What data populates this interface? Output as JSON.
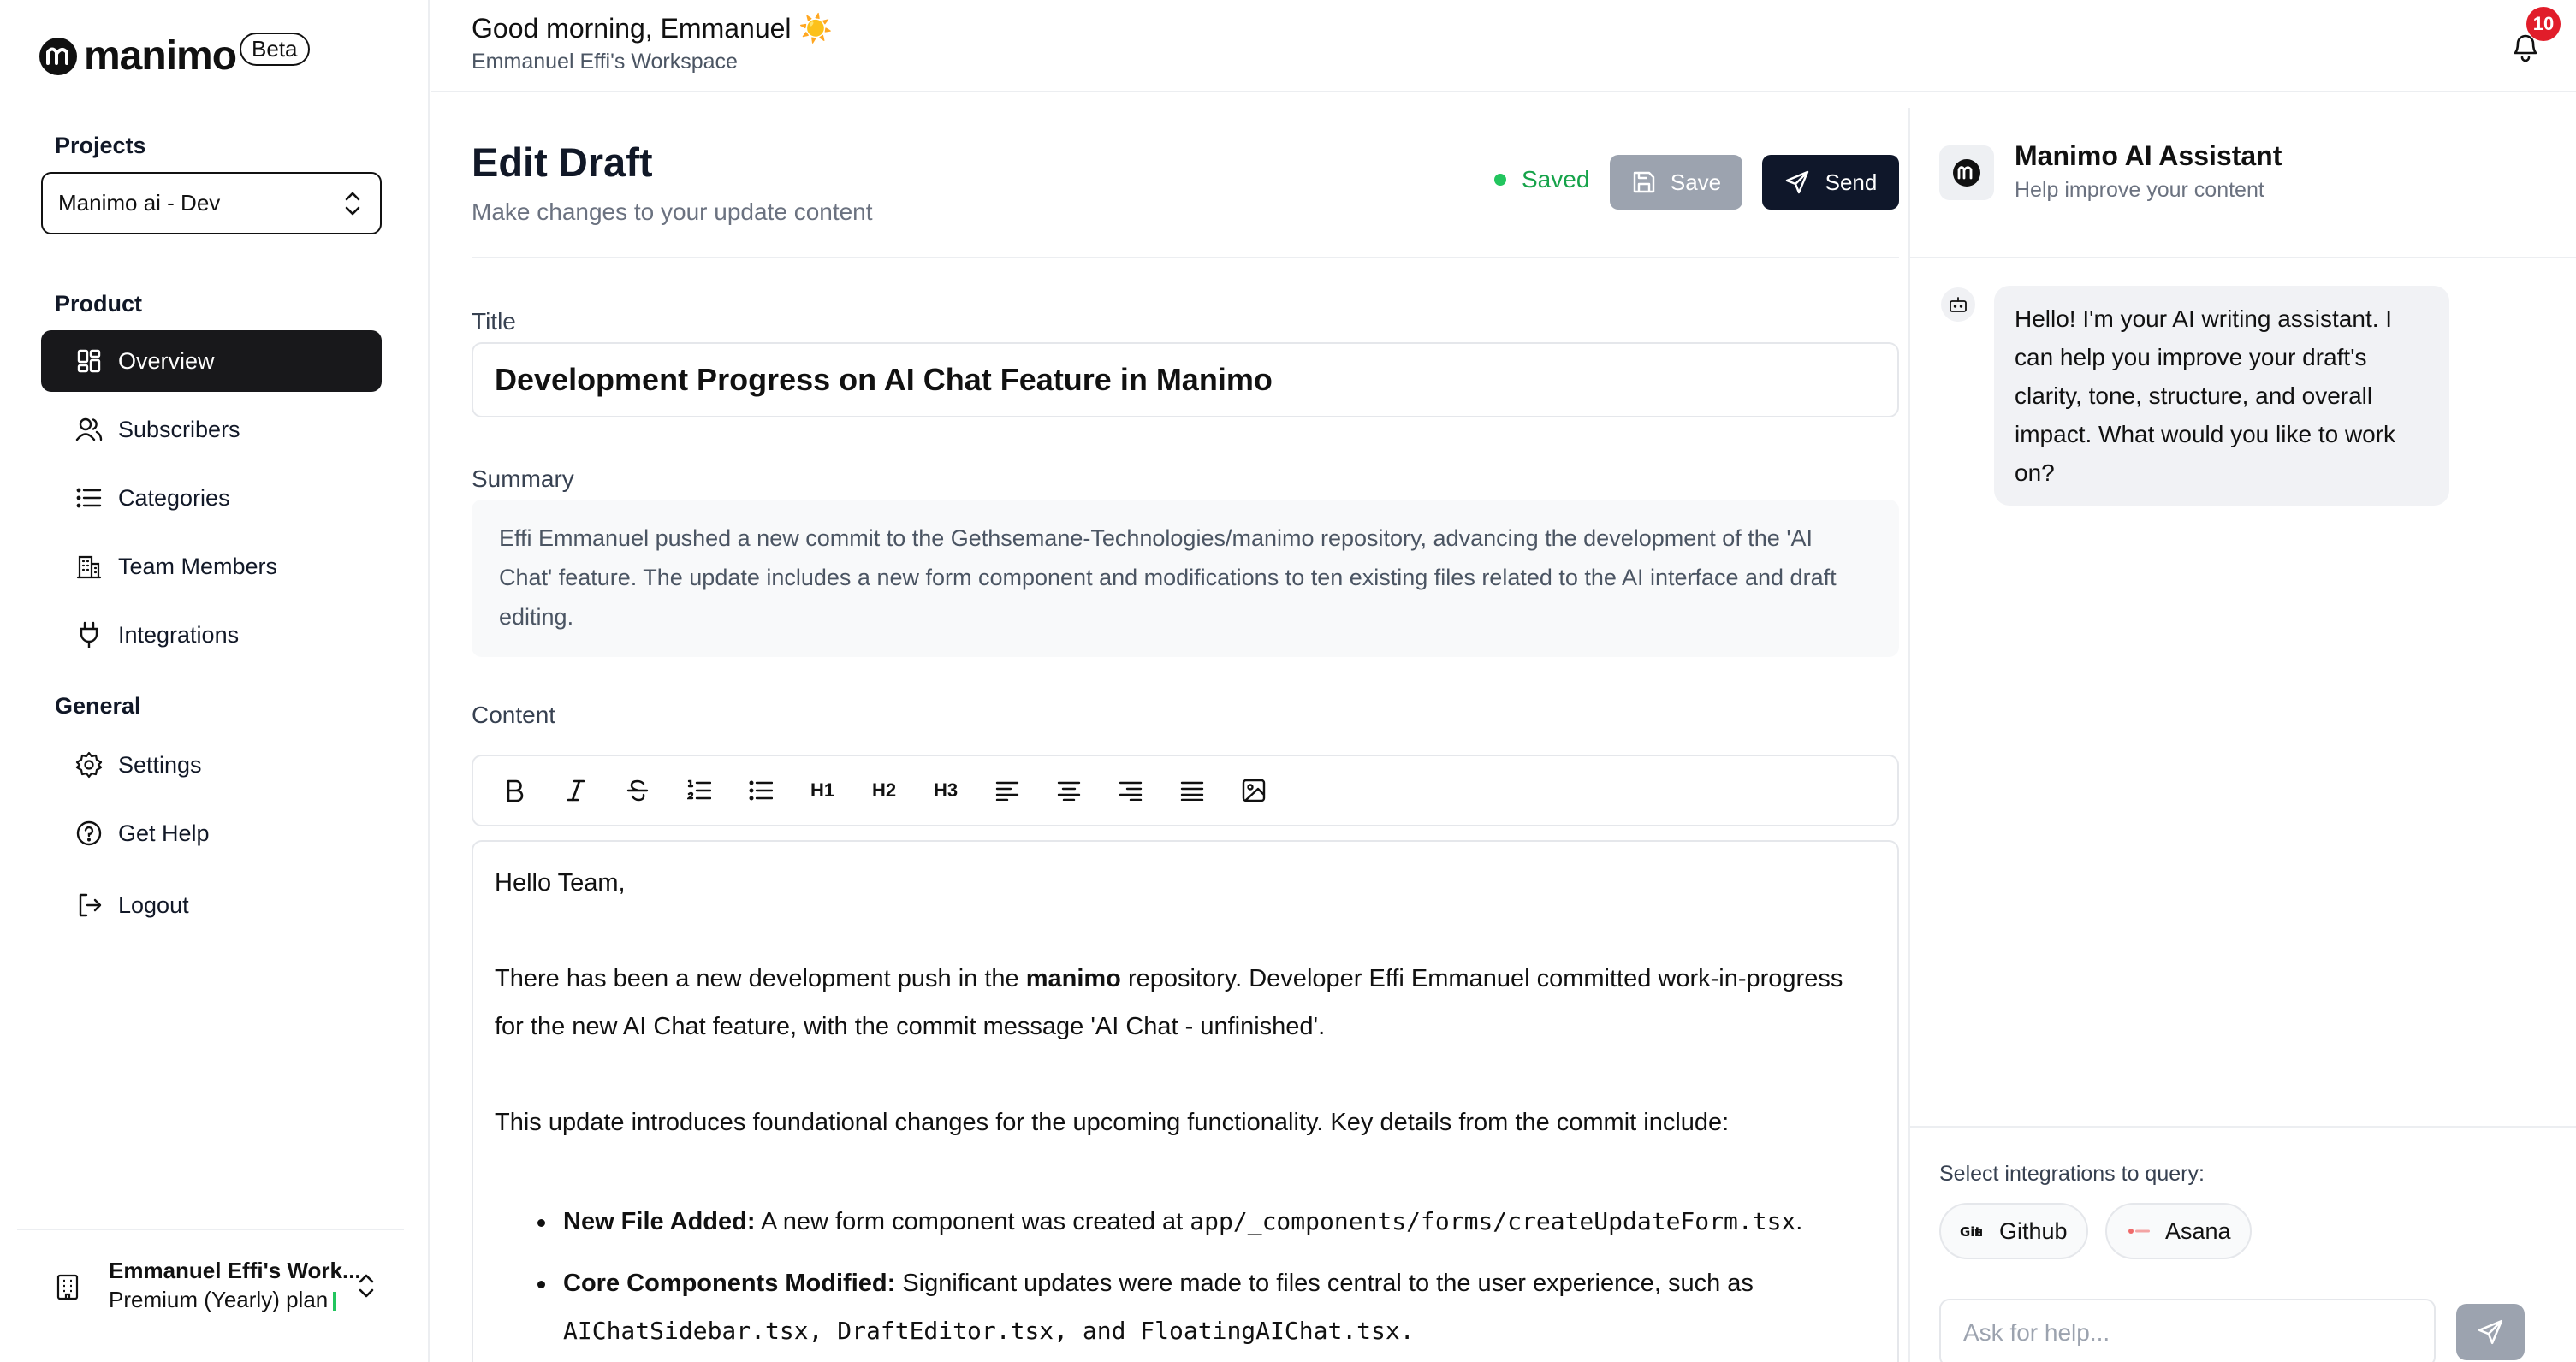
{
  "brand": {
    "name": "manimo",
    "badge": "Beta"
  },
  "sidebar": {
    "projects_label": "Projects",
    "project_select": {
      "value": "Manimo ai - Dev"
    },
    "product_label": "Product",
    "product_items": [
      {
        "label": "Overview",
        "icon": "dashboard-icon",
        "active": true
      },
      {
        "label": "Subscribers",
        "icon": "users-icon"
      },
      {
        "label": "Categories",
        "icon": "list-icon"
      },
      {
        "label": "Team Members",
        "icon": "building-icon"
      },
      {
        "label": "Integrations",
        "icon": "plug-icon"
      }
    ],
    "general_label": "General",
    "general_items": [
      {
        "label": "Settings",
        "icon": "gear-icon"
      },
      {
        "label": "Get Help",
        "icon": "help-circle-icon"
      },
      {
        "label": "Logout",
        "icon": "logout-icon"
      }
    ],
    "workspace": {
      "name": "Emmanuel Effi's Work...",
      "plan": "Premium (Yearly) plan"
    }
  },
  "header": {
    "greeting": "Good morning, Emmanuel",
    "greeting_emoji": "☀️",
    "workspace": "Emmanuel Effi's Workspace",
    "notifications_count": "10"
  },
  "editor": {
    "title": "Edit Draft",
    "subtitle": "Make changes to your update content",
    "status": "Saved",
    "save_label": "Save",
    "send_label": "Send",
    "title_label": "Title",
    "title_value": "Development Progress on AI Chat Feature in Manimo",
    "summary_label": "Summary",
    "summary_value": "Effi Emmanuel pushed a new commit to the Gethsemane-Technologies/manimo repository, advancing the development of the 'AI Chat' feature. The update includes a new form component and modifications to ten existing files related to the AI interface and draft editing.",
    "content_label": "Content",
    "toolbar": [
      "bold",
      "italic",
      "strikethrough",
      "ordered-list",
      "bullet-list",
      "H1",
      "H2",
      "H3",
      "align-left",
      "align-center",
      "align-right",
      "justify",
      "image"
    ],
    "content": {
      "greeting": "Hello Team,",
      "p1_before": "There has been a new development push in the ",
      "p1_bold": "manimo",
      "p1_after": " repository. Developer Effi Emmanuel committed work-in-progress for the new AI Chat feature, with the commit message 'AI Chat - unfinished'.",
      "p2": "This update introduces foundational changes for the upcoming functionality. Key details from the commit include:",
      "bullets": [
        {
          "bold": "New File Added:",
          "text": " A new form component was created at ",
          "code": "app/_components/forms/createUpdateForm.tsx",
          "after": "."
        },
        {
          "bold": "Core Components Modified:",
          "text": " Significant updates were made to files central to the user experience, such as",
          "code": "AIChatSidebar.tsx, DraftEditor.tsx, and FloatingAIChat.tsx.",
          "after": ""
        }
      ]
    }
  },
  "ai_panel": {
    "title": "Manimo AI Assistant",
    "subtitle": "Help improve your content",
    "message": "Hello! I'm your AI writing assistant. I can help you improve your draft's clarity, tone, structure, and overall impact. What would you like to work on?",
    "integrations_label": "Select integrations to query:",
    "integrations": [
      {
        "label": "Github",
        "icon": "github-icon"
      },
      {
        "label": "Asana",
        "icon": "asana-icon"
      }
    ],
    "input_placeholder": "Ask for help..."
  }
}
